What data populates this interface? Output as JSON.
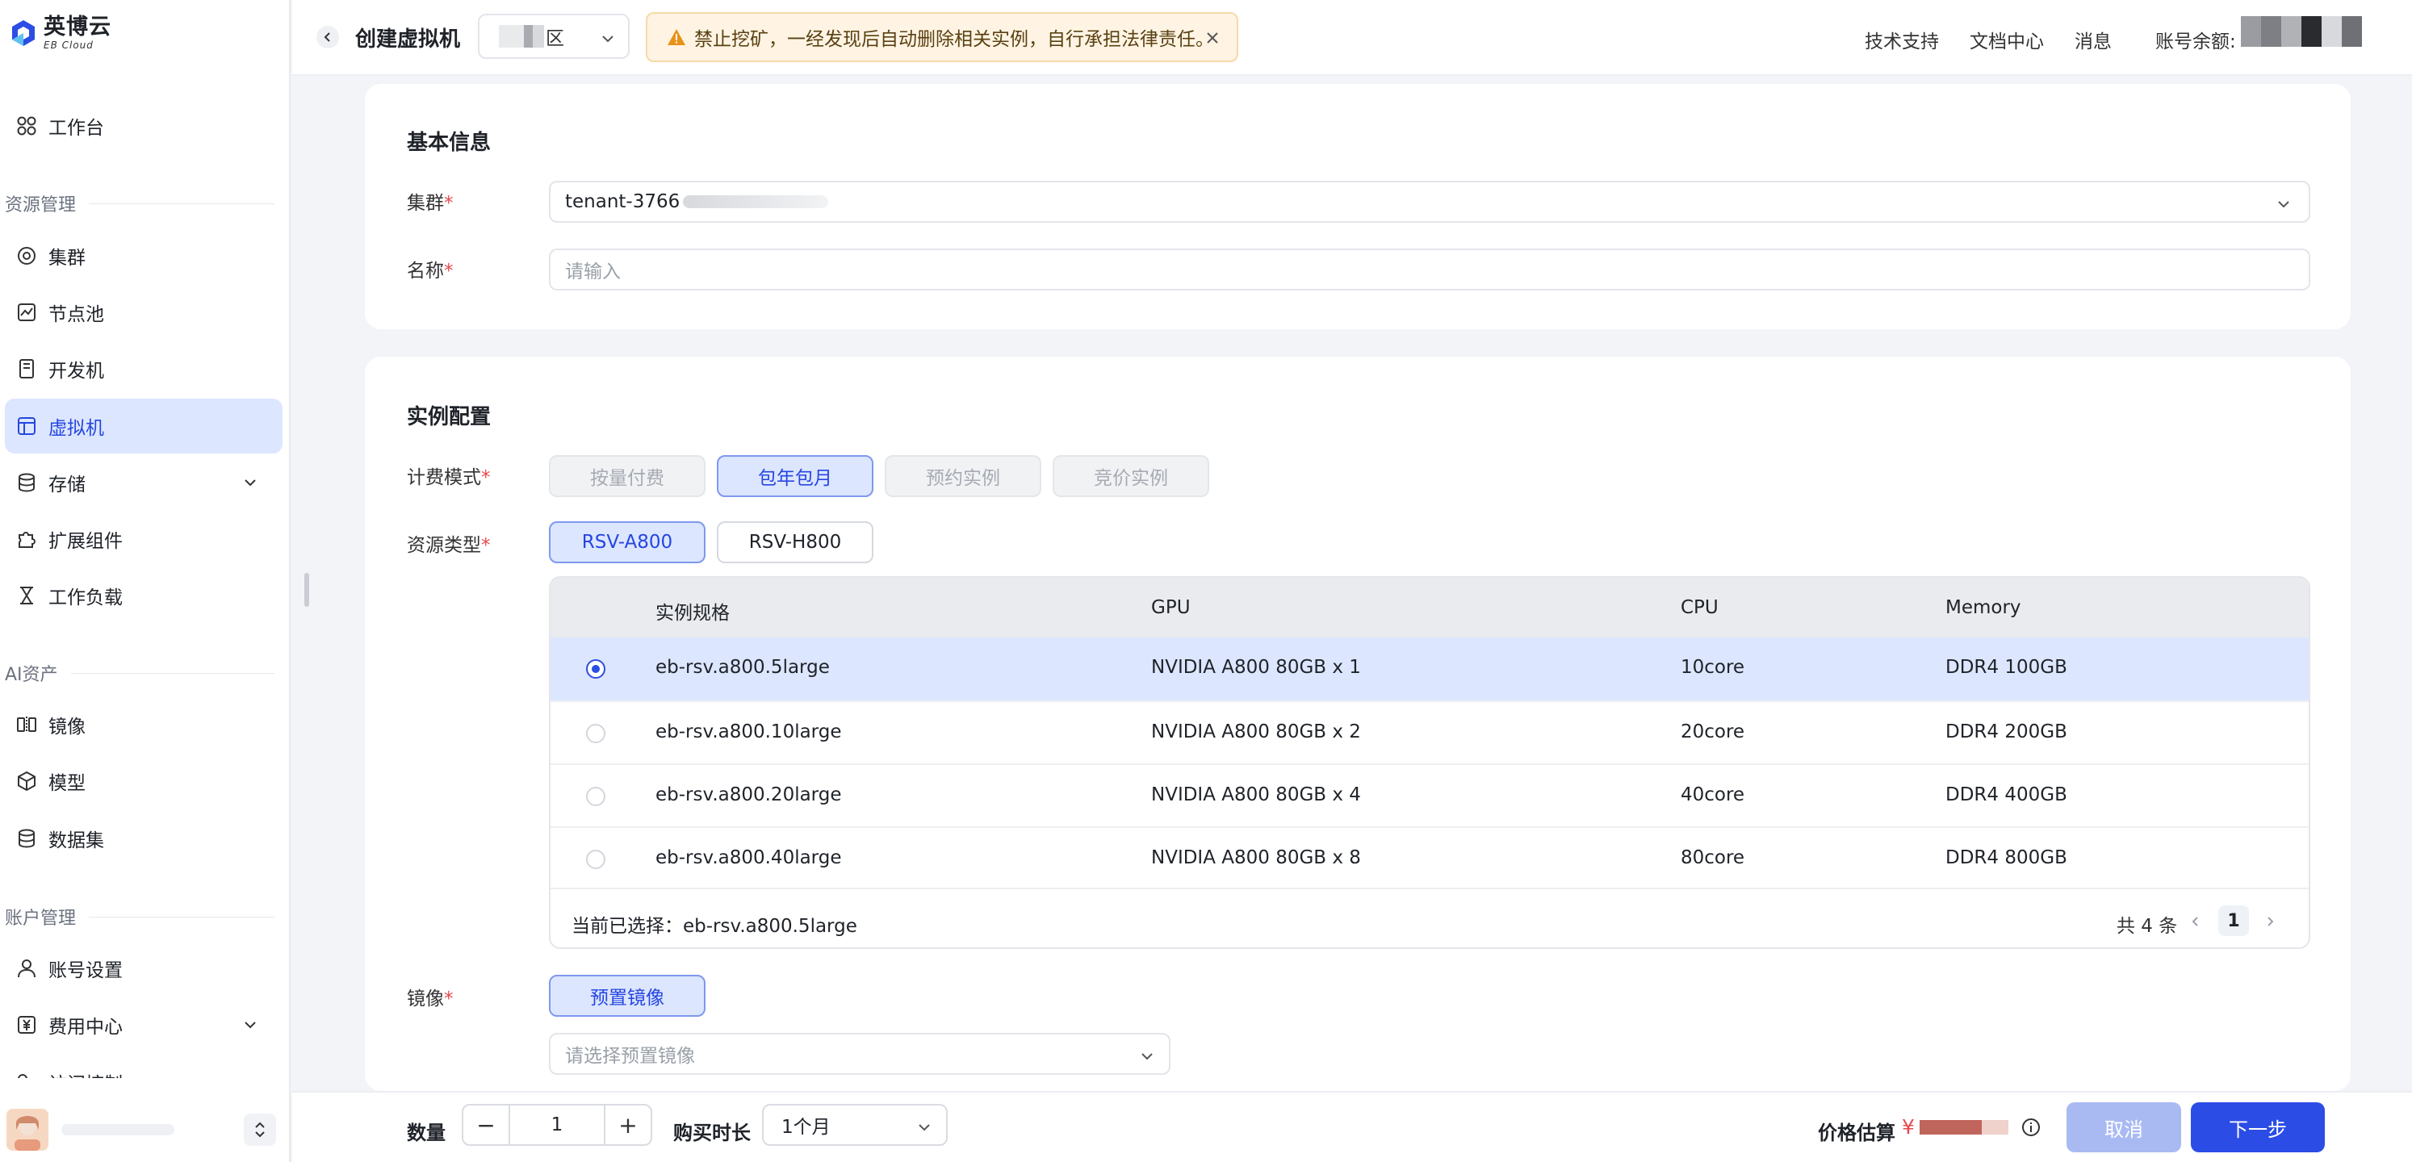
{
  "brand": {
    "name_cn": "英博云",
    "name_en": "EB Cloud"
  },
  "sidebar": {
    "workbench": "工作台",
    "sections": {
      "resources": "资源管理",
      "ai_assets": "AI资产",
      "account": "账户管理"
    },
    "items": [
      {
        "label": "集群",
        "icon": "cluster-icon"
      },
      {
        "label": "节点池",
        "icon": "chart-icon"
      },
      {
        "label": "开发机",
        "icon": "dev-machine-icon"
      },
      {
        "label": "虚拟机",
        "icon": "vm-icon",
        "active": true
      },
      {
        "label": "存储",
        "icon": "database-icon"
      },
      {
        "label": "扩展组件",
        "icon": "puzzle-icon"
      },
      {
        "label": "工作负载",
        "icon": "hourglass-icon"
      },
      {
        "label": "镜像",
        "icon": "mirror-icon"
      },
      {
        "label": "模型",
        "icon": "cube-icon"
      },
      {
        "label": "数据集",
        "icon": "database-icon"
      },
      {
        "label": "账号设置",
        "icon": "user-icon"
      },
      {
        "label": "费用中心",
        "icon": "yen-icon"
      },
      {
        "label": "访问控制",
        "icon": "key-icon"
      }
    ]
  },
  "header": {
    "title": "创建虚拟机",
    "region_suffix": "区",
    "banner": "禁止挖矿，一经发现后自动删除相关实例，自行承担法律责任。",
    "links": {
      "support": "技术支持",
      "docs": "文档中心",
      "messages": "消息",
      "balance": "账号余额:"
    }
  },
  "basic": {
    "title": "基本信息",
    "cluster_label": "集群",
    "cluster_value": "tenant-3766",
    "name_label": "名称",
    "name_placeholder": "请输入"
  },
  "instance": {
    "title": "实例配置",
    "billing_label": "计费模式",
    "billing_options": [
      "按量付费",
      "包年包月",
      "预约实例",
      "竞价实例"
    ],
    "billing_selected": "包年包月",
    "resource_label": "资源类型",
    "resource_options": [
      "RSV-A800",
      "RSV-H800"
    ],
    "resource_selected": "RSV-A800",
    "table": {
      "headers": [
        "实例规格",
        "GPU",
        "CPU",
        "Memory"
      ],
      "rows": [
        {
          "spec": "eb-rsv.a800.5large",
          "gpu": "NVIDIA A800 80GB x 1",
          "cpu": "10core",
          "memory": "DDR4 100GB",
          "selected": true
        },
        {
          "spec": "eb-rsv.a800.10large",
          "gpu": "NVIDIA A800 80GB x 2",
          "cpu": "20core",
          "memory": "DDR4 200GB"
        },
        {
          "spec": "eb-rsv.a800.20large",
          "gpu": "NVIDIA A800 80GB x 4",
          "cpu": "40core",
          "memory": "DDR4 400GB"
        },
        {
          "spec": "eb-rsv.a800.40large",
          "gpu": "NVIDIA A800 80GB x 8",
          "cpu": "80core",
          "memory": "DDR4 800GB"
        }
      ],
      "selected_label": "当前已选择：",
      "selected_value": "eb-rsv.a800.5large",
      "total": "共 4 条",
      "page": "1"
    },
    "image_label": "镜像",
    "image_option": "预置镜像",
    "image_placeholder": "请选择预置镜像"
  },
  "footer": {
    "quantity_label": "数量",
    "quantity_value": "1",
    "minus": "−",
    "plus": "+",
    "duration_label": "购买时长",
    "duration_value": "1个月",
    "price_label": "价格估算",
    "currency": "¥",
    "cancel": "取消",
    "next": "下一步"
  },
  "colors": {
    "primary": "#2b4de6",
    "selected_bg": "#dce6ff",
    "cancel_bg": "#a9baf3",
    "warning": "#e8921a",
    "required": "#e5484d"
  }
}
